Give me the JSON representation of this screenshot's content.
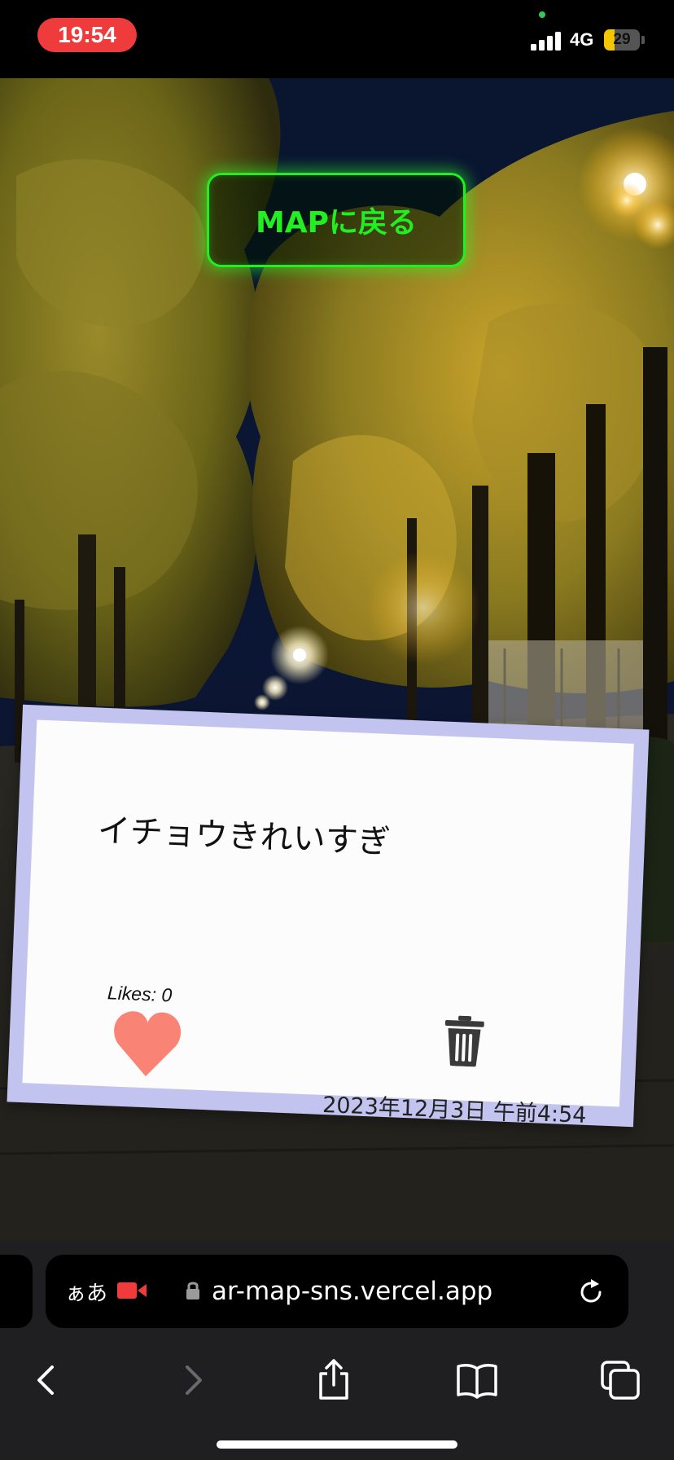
{
  "status_bar": {
    "time": "19:54",
    "network": "4G",
    "battery": "29",
    "battery_level": 0.29
  },
  "ar_view": {
    "back_button_label": "MAPに戻る"
  },
  "post": {
    "text": "イチョウきれいすぎ",
    "likes_label": "Likes: 0",
    "timestamp": "2023年12月3日 午前4:54"
  },
  "browser": {
    "text_size_label": "ぁあ",
    "url": "ar-map-sns.vercel.app"
  },
  "icons": {
    "heart": "heart-icon",
    "trash": "trash-icon",
    "lock": "lock-icon",
    "record": "screen-record-icon",
    "reload": "reload-icon",
    "back": "chevron-left-icon",
    "forward": "chevron-right-icon",
    "share": "share-icon",
    "bookmarks": "book-icon",
    "tabs": "tabs-icon"
  },
  "colors": {
    "record_red": "#ef3b3b",
    "neon_green": "#22ee22",
    "card_border": "#c2c4ef",
    "heart": "#f98476"
  }
}
